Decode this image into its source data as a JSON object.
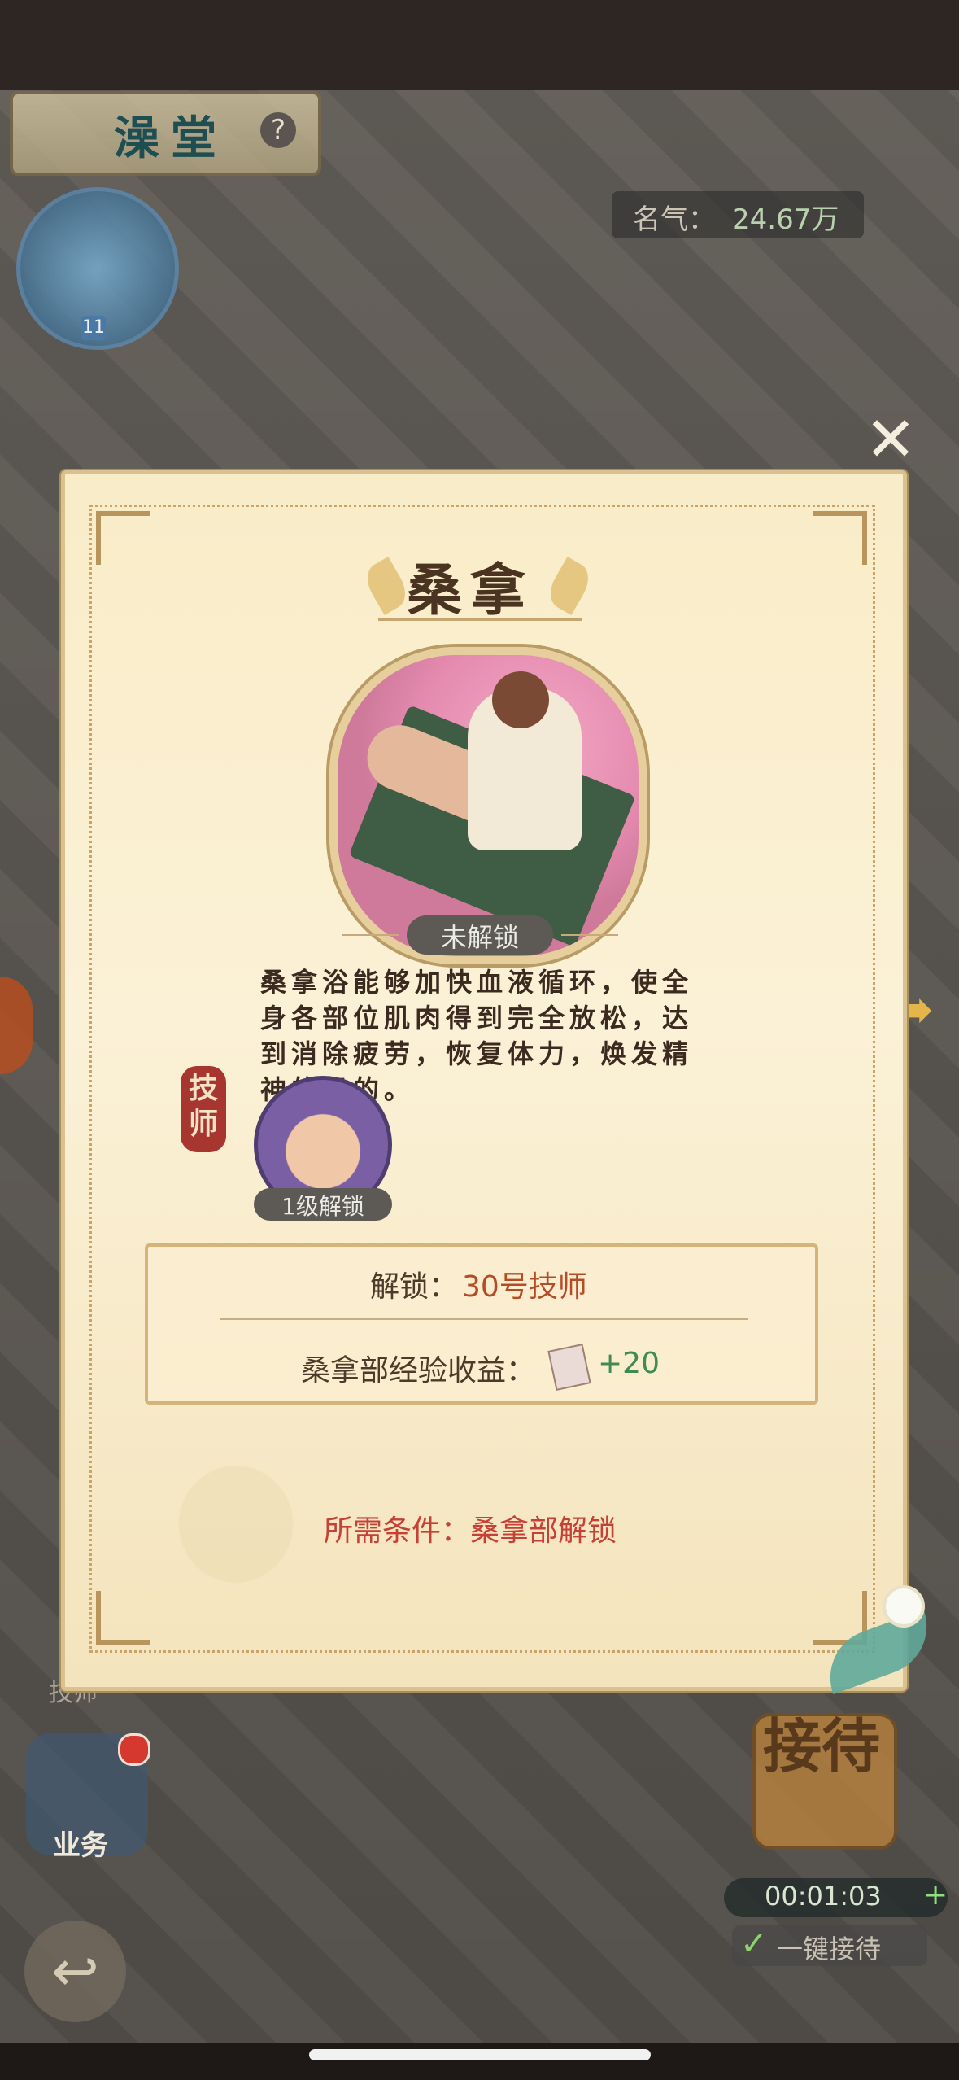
{
  "header": {
    "location_label": "澡堂",
    "help_icon": "?",
    "fame_label": "名气：",
    "fame_value": "24.67万",
    "player_level": "11"
  },
  "modal": {
    "title": "桑拿",
    "status": "未解锁",
    "description": "桑拿浴能够加快血液循环，使全身各部位肌肉得到完全放松，达到消除疲劳，恢复体力，焕发精神的目的。",
    "technician_tag": "技师",
    "technician_unlock": "1级解锁",
    "unlock_label": "解锁：",
    "unlock_value": "30号技师",
    "exp_label": "桑拿部经验收益：",
    "exp_value": "+20",
    "requirement": "所需条件：桑拿部解锁",
    "close_icon": "✕"
  },
  "hud": {
    "tech_nav_label": "技师",
    "business_label": "业务",
    "reception_label": "接待",
    "timer": "00:01:03",
    "timer_plus": "+",
    "one_click_reception": "一键接待",
    "back_icon": "↩"
  },
  "colors": {
    "modal_bg": "#fbf1d6",
    "title": "#4a3320",
    "unlock_value": "#b54c25",
    "exp_value": "#3f8b52",
    "requirement": "#c64036"
  }
}
